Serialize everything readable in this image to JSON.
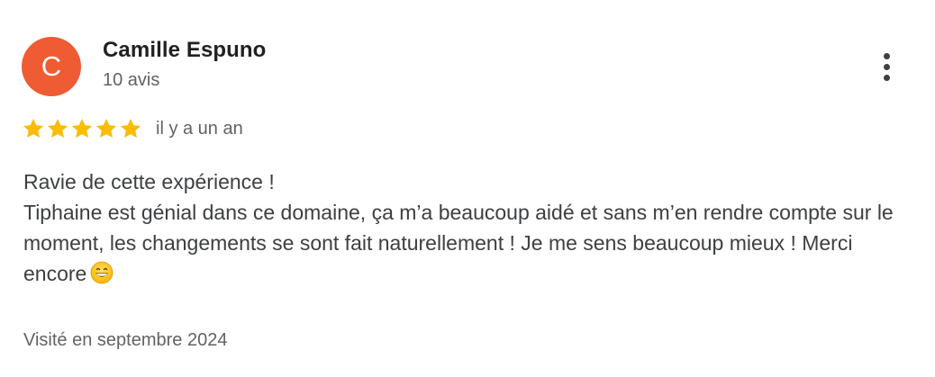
{
  "review": {
    "avatar_letter": "C",
    "avatar_color": "#ef5b33",
    "author_name": "Camille Espuno",
    "author_reviews": "10 avis",
    "menu_icon": "more-vert-icon",
    "rating": 5,
    "rating_max": 5,
    "star_color": "#fbbc04",
    "time_ago": "il y a un an",
    "text_lines": [
      "Ravie de cette expérience !",
      "Tiphaine est génial dans ce domaine, ça m’a beaucoup aidé et sans m’en rendre compte sur le moment, les changements se sont fait naturellement ! Je me sens beaucoup mieux ! Merci encore"
    ],
    "emoji_icon": "grinning-face-icon",
    "visited": "Visité en septembre 2024"
  }
}
